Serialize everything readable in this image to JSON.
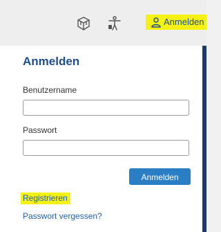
{
  "header": {
    "icons": [
      "gift-box-icon",
      "accessibility-icon"
    ],
    "login_label": "Anmelden",
    "highlight_color": "#f5f110"
  },
  "login_panel": {
    "title": "Anmelden",
    "username_label": "Benutzername",
    "username_value": "",
    "password_label": "Passwort",
    "password_value": "",
    "submit_label": "Anmelden",
    "register_label": "Registrieren",
    "forgot_label": "Passwort vergessen?",
    "accent_color": "#2a7fc4",
    "title_color": "#1f4e8c"
  }
}
